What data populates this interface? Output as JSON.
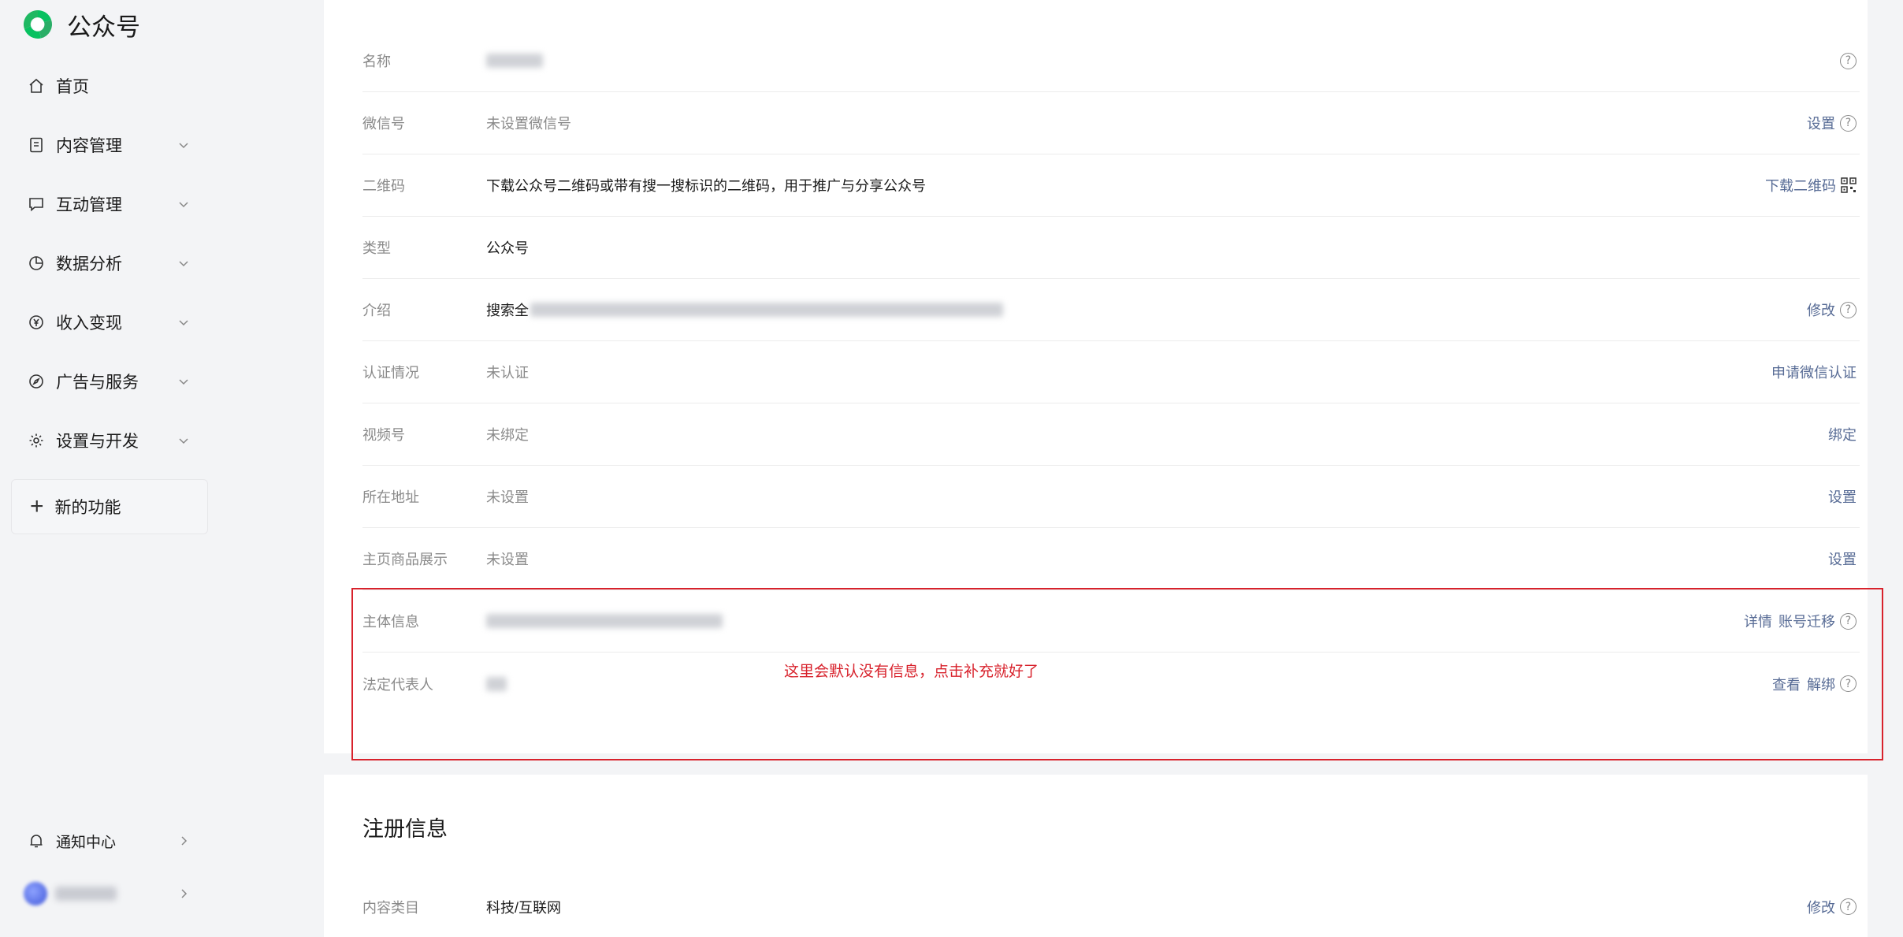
{
  "app": {
    "title": "公众号"
  },
  "sidebar": {
    "items": [
      {
        "label": "首页",
        "icon": "home-icon"
      },
      {
        "label": "内容管理",
        "icon": "document-icon"
      },
      {
        "label": "互动管理",
        "icon": "chat-icon"
      },
      {
        "label": "数据分析",
        "icon": "pie-chart-icon"
      },
      {
        "label": "收入变现",
        "icon": "yen-icon"
      },
      {
        "label": "广告与服务",
        "icon": "compass-icon"
      },
      {
        "label": "设置与开发",
        "icon": "gear-icon"
      }
    ],
    "new_feature": "新的功能",
    "notifications": "通知中心"
  },
  "account": {
    "rows": [
      {
        "label": "名称",
        "value": "",
        "actions": []
      },
      {
        "label": "微信号",
        "value": "未设置微信号",
        "actions": [
          "设置"
        ]
      },
      {
        "label": "二维码",
        "value": "下载公众号二维码或带有搜一搜标识的二维码，用于推广与分享公众号",
        "actions": [
          "下载二维码"
        ]
      },
      {
        "label": "类型",
        "value": "公众号",
        "actions": []
      },
      {
        "label": "介绍",
        "value": "搜索全",
        "actions": [
          "修改"
        ]
      },
      {
        "label": "认证情况",
        "value": "未认证",
        "actions": [
          "申请微信认证"
        ]
      },
      {
        "label": "视频号",
        "value": "未绑定",
        "actions": [
          "绑定"
        ]
      },
      {
        "label": "所在地址",
        "value": "未设置",
        "actions": [
          "设置"
        ]
      },
      {
        "label": "主页商品展示",
        "value": "未设置",
        "actions": [
          "设置"
        ]
      },
      {
        "label": "主体信息",
        "value": "",
        "actions": [
          "详情",
          "账号迁移"
        ]
      },
      {
        "label": "法定代表人",
        "value": "",
        "actions": [
          "查看",
          "解绑"
        ]
      }
    ]
  },
  "annotation": {
    "text": "这里会默认没有信息，点击补充就好了",
    "color": "#d8222c"
  },
  "registration": {
    "title": "注册信息",
    "rows": [
      {
        "label": "内容类目",
        "value": "科技/互联网",
        "actions": [
          "修改"
        ]
      }
    ]
  },
  "colors": {
    "link": "#576b95",
    "brand": "#07c160",
    "annotation": "#d8222c"
  }
}
